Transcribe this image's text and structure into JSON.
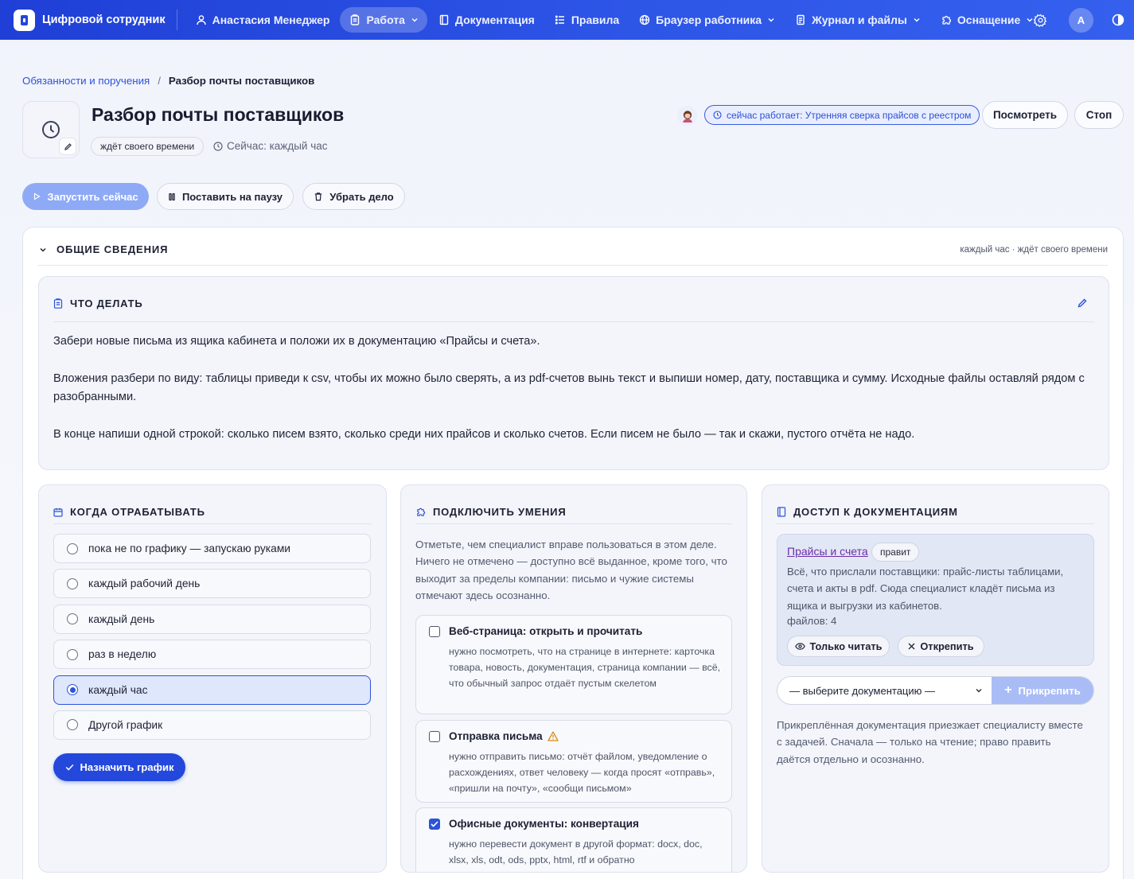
{
  "app": {
    "name": "Цифровой сотрудник"
  },
  "nav": {
    "items": [
      {
        "label": "Анастасия Менеджер",
        "icon": "user-icon",
        "active": false,
        "dropdown": false
      },
      {
        "label": "Работа",
        "icon": "clipboard-icon",
        "active": true,
        "dropdown": true
      },
      {
        "label": "Документация",
        "icon": "book-icon",
        "active": false,
        "dropdown": false
      },
      {
        "label": "Правила",
        "icon": "list-icon",
        "active": false,
        "dropdown": false
      },
      {
        "label": "Браузер работника",
        "icon": "globe-icon",
        "active": false,
        "dropdown": true
      },
      {
        "label": "Журнал и файлы",
        "icon": "document-icon",
        "active": false,
        "dropdown": true
      },
      {
        "label": "Оснащение",
        "icon": "puzzle-icon",
        "active": false,
        "dropdown": true
      }
    ],
    "avatar_letter": "A"
  },
  "breadcrumb": {
    "parent": "Обязанности и поручения",
    "separator": "/",
    "current": "Разбор почты поставщиков"
  },
  "task": {
    "title": "Разбор почты поставщиков",
    "status": "ждёт своего времени",
    "schedule_now": "Сейчас: каждый час",
    "working_now": "сейчас работает: Утренняя сверка прайсов с реестром",
    "view_label": "Посмотреть",
    "stop_label": "Стоп"
  },
  "actions": {
    "run_now": "Запустить сейчас",
    "pause": "Поставить на паузу",
    "remove": "Убрать дело"
  },
  "overview": {
    "title": "ОБЩИЕ СВЕДЕНИЯ",
    "meta": "каждый час · ждёт своего времени"
  },
  "instructions": {
    "title": "ЧТО ДЕЛАТЬ",
    "paragraphs": [
      "Забери новые письма из ящика кабинета и положи их в документацию «Прайсы и счета».",
      "Вложения разбери по виду: таблицы приведи к csv, чтобы их можно было сверять, а из pdf-счетов вынь текст и выпиши номер, дату, поставщика и сумму. Исходные файлы оставляй рядом с разобранными.",
      "В конце напиши одной строкой: сколько писем взято, сколько среди них прайсов и сколько счетов. Если писем не было — так и скажи, пустого отчёта не надо."
    ]
  },
  "schedule": {
    "title": "КОГДА ОТРАБАТЫВАТЬ",
    "options": [
      {
        "label": "пока не по графику — запускаю руками",
        "selected": false
      },
      {
        "label": "каждый рабочий день",
        "selected": false
      },
      {
        "label": "каждый день",
        "selected": false
      },
      {
        "label": "раз в неделю",
        "selected": false
      },
      {
        "label": "каждый час",
        "selected": true
      },
      {
        "label": "Другой график",
        "selected": false
      }
    ],
    "assign_label": "Назначить график"
  },
  "skills": {
    "title": "ПОДКЛЮЧИТЬ УМЕНИЯ",
    "intro": "Отметьте, чем специалист вправе пользоваться в этом деле. Ничего не отмечено — доступно всё выданное, кроме того, что выходит за пределы компании: письмо и чужие системы отмечают здесь осознанно.",
    "items": [
      {
        "name": "Веб-страница: открыть и прочитать",
        "checked": false,
        "warning": false,
        "desc": "нужно посмотреть, что на странице в интернете: карточка товара, новость, документация, страница компании — всё, что обычный запрос отдаёт пустым скелетом"
      },
      {
        "name": "Отправка письма",
        "checked": false,
        "warning": true,
        "desc": "нужно отправить письмо: отчёт файлом, уведомление о расхождениях, ответ человеку — когда просят «отправь», «пришли на почту», «сообщи письмом»"
      },
      {
        "name": "Офисные документы: конвертация",
        "checked": true,
        "warning": false,
        "desc": "нужно перевести документ в другой формат: docx, doc, xlsx, xls, odt, ods, pptx, html, rtf и обратно"
      }
    ]
  },
  "docs": {
    "title": "ДОСТУП К ДОКУМЕНТАЦИЯМ",
    "attached": {
      "name": "Прайсы и счета",
      "role": "правит",
      "desc": "Всё, что прислали поставщики: прайс-листы таблицами, счета и акты в pdf. Сюда специалист кладёт письма из ящика и выгрузки из кабинетов.",
      "files": "файлов: 4",
      "read_only_label": "Только читать",
      "unpin_label": "Открепить"
    },
    "select_placeholder": "— выберите документацию —",
    "attach_label": "Прикрепить",
    "note": "Прикреплённая документация приезжает специалисту вместе с задачей. Сначала — только на чтение; право править даётся отдельно и осознанно."
  }
}
